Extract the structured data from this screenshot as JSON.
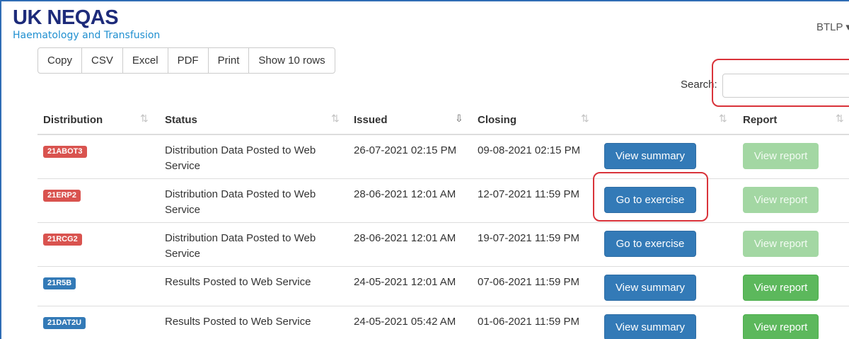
{
  "header": {
    "logo_title": "UK NEQAS",
    "logo_subtitle": "Haematology and Transfusion",
    "user_menu": "BTLP ▾"
  },
  "toolbar": {
    "buttons": [
      "Copy",
      "CSV",
      "Excel",
      "PDF",
      "Print",
      "Show 10 rows"
    ]
  },
  "search": {
    "label": "Search:",
    "value": ""
  },
  "table": {
    "columns": [
      "Distribution",
      "Status",
      "Issued",
      "Closing",
      "",
      "Report"
    ],
    "sort_icons": [
      "⇅",
      "⇅",
      "⇩",
      "⇅",
      "⇅",
      "⇅"
    ],
    "rows": [
      {
        "distribution": "21ABOT3",
        "status": "Distribution Data Posted to Web Service",
        "issued": "26-07-2021 02:15 PM",
        "closing": "09-08-2021 02:15 PM",
        "action": "View summary",
        "report": "View report",
        "label_color": "#d9534f",
        "report_enabled": false
      },
      {
        "distribution": "21ERP2",
        "status": "Distribution Data Posted to Web Service",
        "issued": "28-06-2021 12:01 AM",
        "closing": "12-07-2021 11:59 PM",
        "action": "Go to exercise",
        "report": "View report",
        "label_color": "#d9534f",
        "report_enabled": false
      },
      {
        "distribution": "21RCG2",
        "status": "Distribution Data Posted to Web Service",
        "issued": "28-06-2021 12:01 AM",
        "closing": "19-07-2021 11:59 PM",
        "action": "Go to exercise",
        "report": "View report",
        "label_color": "#d9534f",
        "report_enabled": false
      },
      {
        "distribution": "21R5B",
        "status": "Results Posted to Web Service",
        "issued": "24-05-2021 12:01 AM",
        "closing": "07-06-2021 11:59 PM",
        "action": "View summary",
        "report": "View report",
        "label_color": "#337ab7",
        "report_enabled": true
      },
      {
        "distribution": "21DAT2U",
        "status": "Results Posted to Web Service",
        "issued": "24-05-2021 05:42 AM",
        "closing": "01-06-2021 11:59 PM",
        "action": "View summary",
        "report": "View report",
        "label_color": "#337ab7",
        "report_enabled": true
      }
    ]
  },
  "annotations": {
    "highlight_color": "#d9333a"
  }
}
